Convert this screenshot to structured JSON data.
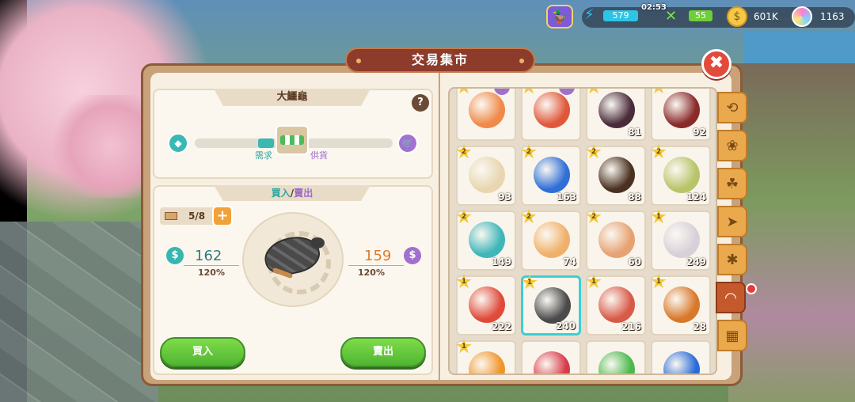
{
  "hud": {
    "energy": "579",
    "timer": "02:53",
    "food": "55",
    "coins": "601K",
    "gems": "1163"
  },
  "window": {
    "title": "交易集市"
  },
  "item": {
    "name": "大鱷龜",
    "demand_label": "需求",
    "supply_label": "供貨"
  },
  "trade": {
    "tab_buy": "買入",
    "tab_sep": "/",
    "tab_sell": "賣出",
    "stock": "5/8",
    "buy_price": "162",
    "buy_pct": "120%",
    "sell_price": "159",
    "sell_pct": "120%",
    "buy_button": "買入",
    "sell_button": "賣出"
  },
  "grid_items": [
    {
      "name": "seahorse",
      "stars": "3",
      "count": "",
      "color": "#f08a4a",
      "cart": true
    },
    {
      "name": "crab",
      "stars": "3",
      "count": "",
      "color": "#e0573a",
      "cart": true
    },
    {
      "name": "mussel",
      "stars": "3",
      "count": "81",
      "color": "#4a2b3a",
      "cart": false
    },
    {
      "name": "sea-urchin",
      "stars": "3",
      "count": "92",
      "color": "#8a2a2a",
      "cart": false
    },
    {
      "name": "shrimp",
      "stars": "2",
      "count": "93",
      "color": "#e8d6b0",
      "cart": false
    },
    {
      "name": "sea-slug",
      "stars": "2",
      "count": "163",
      "color": "#2f6fd6",
      "cart": false
    },
    {
      "name": "lobster",
      "stars": "2",
      "count": "88",
      "color": "#4a3020",
      "cart": false
    },
    {
      "name": "anemone",
      "stars": "2",
      "count": "124",
      "color": "#b8c46a",
      "cart": false
    },
    {
      "name": "turban-shell",
      "stars": "2",
      "count": "149",
      "color": "#3fb6b8",
      "cart": false
    },
    {
      "name": "scallop",
      "stars": "2",
      "count": "74",
      "color": "#f0b06a",
      "cart": false
    },
    {
      "name": "clam",
      "stars": "2",
      "count": "60",
      "color": "#e6a272",
      "cart": false
    },
    {
      "name": "oyster",
      "stars": "1",
      "count": "249",
      "color": "#d8d0d8",
      "cart": false
    },
    {
      "name": "starfish",
      "stars": "1",
      "count": "222",
      "color": "#e04a3a",
      "cart": false
    },
    {
      "name": "snapping-turtle",
      "stars": "1",
      "count": "240",
      "color": "#4b4a4a",
      "cart": false
    },
    {
      "name": "mantis-shrimp",
      "stars": "1",
      "count": "216",
      "color": "#d85a48",
      "cart": false
    },
    {
      "name": "spider-crab",
      "stars": "1",
      "count": "28",
      "color": "#d8782a",
      "cart": false
    },
    {
      "name": "coral-orange",
      "stars": "1",
      "count": "",
      "color": "#f0952a",
      "cart": false
    },
    {
      "name": "coral-red",
      "stars": "",
      "count": "",
      "color": "#d83a4a",
      "cart": false
    },
    {
      "name": "seaweed",
      "stars": "",
      "count": "",
      "color": "#4ab84a",
      "cart": false
    },
    {
      "name": "blue-sponge",
      "stars": "",
      "count": "",
      "color": "#2a6ad8",
      "cart": false
    }
  ],
  "side_tabs": [
    "history-icon",
    "plant-icon",
    "produce-icon",
    "fish-icon",
    "bug-icon",
    "shell-icon",
    "misc-icon"
  ]
}
